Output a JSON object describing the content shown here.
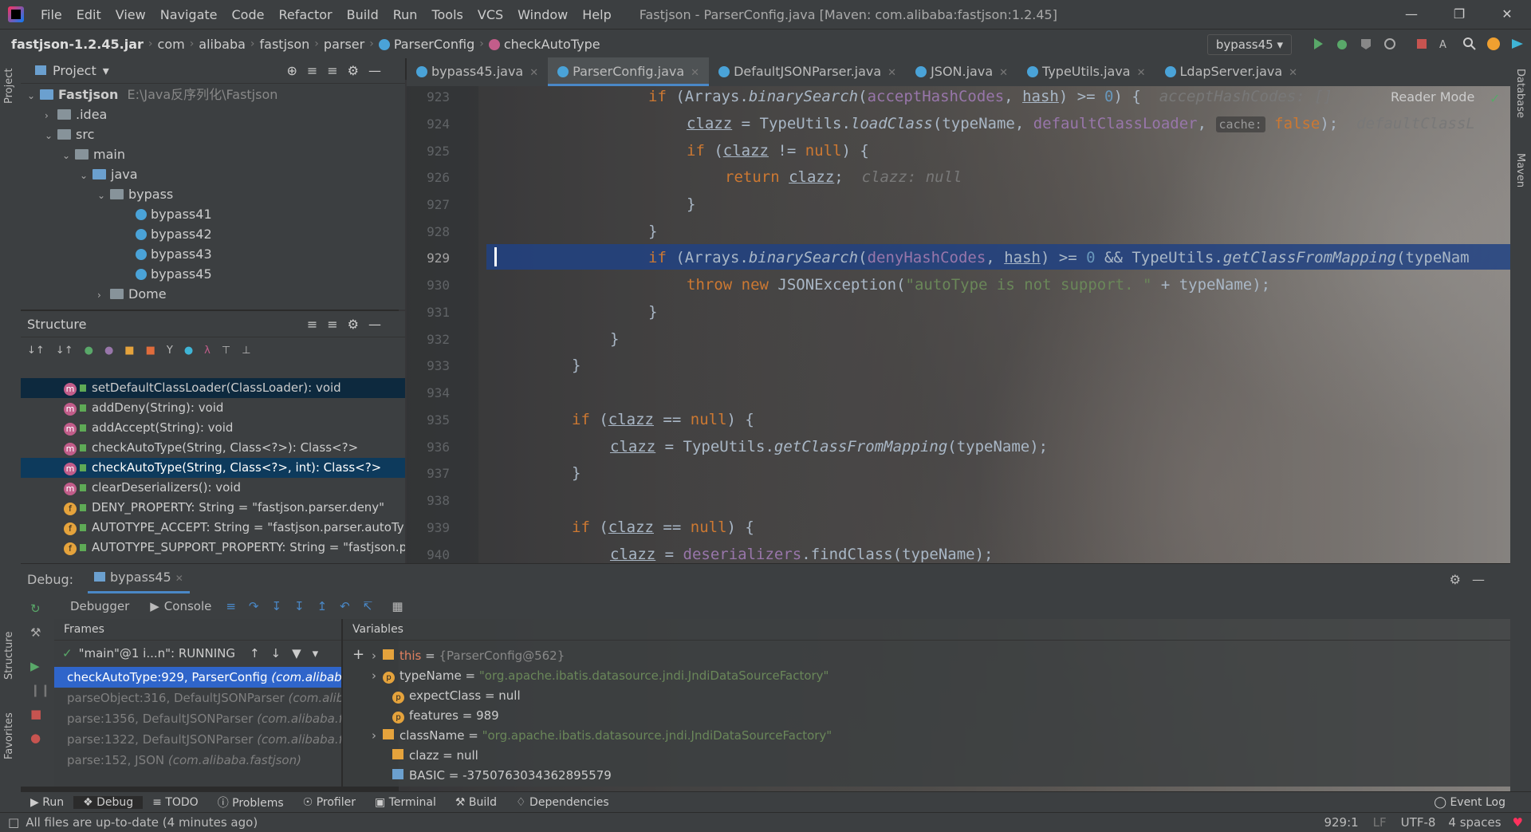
{
  "menubar": {
    "items": [
      "File",
      "Edit",
      "View",
      "Navigate",
      "Code",
      "Refactor",
      "Build",
      "Run",
      "Tools",
      "VCS",
      "Window",
      "Help"
    ],
    "title": "Fastjson - ParserConfig.java [Maven: com.alibaba:fastjson:1.2.45]"
  },
  "navbar": {
    "crumbs": [
      "fastjson-1.2.45.jar",
      "com",
      "alibaba",
      "fastjson",
      "parser",
      "ParserConfig",
      "checkAutoType"
    ],
    "run_config": "bypass45"
  },
  "side": {
    "project": "Project",
    "structure": "Structure",
    "favorites": "Favorites",
    "database": "Database",
    "maven": "Maven"
  },
  "project": {
    "title": "Project",
    "root": "Fastjson",
    "root_path": "E:\\Java反序列化\\Fastjson",
    "items": [
      ".idea",
      "src",
      "main",
      "java",
      "bypass",
      "bypass41",
      "bypass42",
      "bypass43",
      "bypass45",
      "Dome"
    ]
  },
  "structure": {
    "title": "Structure",
    "items": [
      "setDefaultClassLoader(ClassLoader): void",
      "addDeny(String): void",
      "addAccept(String): void",
      "checkAutoType(String, Class<?>): Class<?>",
      "checkAutoType(String, Class<?>, int): Class<?>",
      "clearDeserializers(): void",
      "DENY_PROPERTY: String = \"fastjson.parser.deny\"",
      "AUTOTYPE_ACCEPT: String = \"fastjson.parser.autoTy",
      "AUTOTYPE_SUPPORT_PROPERTY: String = \"fastjson.p"
    ]
  },
  "editor": {
    "tabs": [
      "bypass45.java",
      "ParserConfig.java",
      "DefaultJSONParser.java",
      "JSON.java",
      "TypeUtils.java",
      "LdapServer.java"
    ],
    "active_tab": "ParserConfig.java",
    "reader_mode": "Reader Mode",
    "line_numbers": [
      "923",
      "924",
      "925",
      "926",
      "927",
      "928",
      "929",
      "930",
      "931",
      "932",
      "933",
      "934",
      "935",
      "936",
      "937",
      "938",
      "939",
      "940"
    ],
    "hints": {
      "accept": "acceptHashCodes: []",
      "cache": "cache:",
      "loader": "defaultClassL",
      "clazz": "clazz: null"
    },
    "strings": {
      "exception": "\"autoType is not support. \""
    }
  },
  "debug": {
    "label": "Debug:",
    "session": "bypass45",
    "tabs": [
      "Debugger",
      "Console"
    ],
    "frames_title": "Frames",
    "variables_title": "Variables",
    "thread": "\"main\"@1 i...n\": RUNNING",
    "frames": [
      {
        "method": "checkAutoType:929, ParserConfig",
        "pkg": "(com.alibaba"
      },
      {
        "method": "parseObject:316, DefaultJSONParser",
        "pkg": "(com.alib"
      },
      {
        "method": "parse:1356, DefaultJSONParser",
        "pkg": "(com.alibaba.fas"
      },
      {
        "method": "parse:1322, DefaultJSONParser",
        "pkg": "(com.alibaba.fas"
      },
      {
        "method": "parse:152, JSON",
        "pkg": "(com.alibaba.fastjson)"
      }
    ],
    "variables": [
      {
        "name": "this",
        "value": "{ParserConfig@562}"
      },
      {
        "name": "typeName",
        "value": "\"org.apache.ibatis.datasource.jndi.JndiDataSourceFactory\""
      },
      {
        "name": "expectClass",
        "value": "null"
      },
      {
        "name": "features",
        "value": "989"
      },
      {
        "name": "className",
        "value": "\"org.apache.ibatis.datasource.jndi.JndiDataSourceFactory\""
      },
      {
        "name": "clazz",
        "value": "null"
      },
      {
        "name": "BASIC",
        "value": "-3750763034362895579"
      }
    ]
  },
  "toolwindows": [
    "Run",
    "Debug",
    "TODO",
    "Problems",
    "Profiler",
    "Terminal",
    "Build",
    "Dependencies"
  ],
  "event_log": "Event Log",
  "status": {
    "message": "All files are up-to-date (4 minutes ago)",
    "position": "929:1",
    "line_sep": "LF",
    "encoding": "UTF-8",
    "indent": "4 spaces"
  },
  "colors": {
    "accent": "#2f65ca",
    "highlight": "#214283",
    "keyword": "#cc7832",
    "string": "#6a8759",
    "field": "#9876aa",
    "number": "#6897bb"
  }
}
